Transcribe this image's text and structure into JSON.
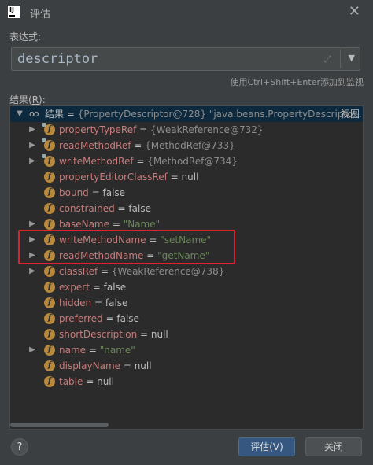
{
  "window": {
    "title": "评估"
  },
  "expression": {
    "label": "表达式:",
    "value": "descriptor",
    "hint": "使用Ctrl+Shift+Enter添加到监视"
  },
  "result": {
    "label_prefix": "结果(",
    "label_mnemonic": "R",
    "label_suffix": "):",
    "root": {
      "name": "结果",
      "eq": " = ",
      "value": "{PropertyDescriptor@728} \"java.beans.PropertyDescripto...",
      "view_link": "视图"
    },
    "fields": [
      {
        "name": "propertyTypeRef",
        "value": "{WeakReference@732}",
        "kind": "ref",
        "expandable": true,
        "locked": true
      },
      {
        "name": "readMethodRef",
        "value": "{MethodRef@733}",
        "kind": "ref",
        "expandable": true,
        "locked": true
      },
      {
        "name": "writeMethodRef",
        "value": "{MethodRef@734}",
        "kind": "ref",
        "expandable": true,
        "locked": true
      },
      {
        "name": "propertyEditorClassRef",
        "value": "null",
        "kind": "plain",
        "expandable": false,
        "locked": false
      },
      {
        "name": "bound",
        "value": "false",
        "kind": "plain",
        "expandable": false,
        "locked": false
      },
      {
        "name": "constrained",
        "value": "false",
        "kind": "plain",
        "expandable": false,
        "locked": false
      },
      {
        "name": "baseName",
        "value": "\"Name\"",
        "kind": "str",
        "expandable": true,
        "locked": false
      },
      {
        "name": "writeMethodName",
        "value": "\"setName\"",
        "kind": "str",
        "expandable": true,
        "locked": false
      },
      {
        "name": "readMethodName",
        "value": "\"getName\"",
        "kind": "str",
        "expandable": true,
        "locked": false
      },
      {
        "name": "classRef",
        "value": "{WeakReference@738}",
        "kind": "ref",
        "expandable": true,
        "locked": false
      },
      {
        "name": "expert",
        "value": "false",
        "kind": "plain",
        "expandable": false,
        "locked": false
      },
      {
        "name": "hidden",
        "value": "false",
        "kind": "plain",
        "expandable": false,
        "locked": false
      },
      {
        "name": "preferred",
        "value": "false",
        "kind": "plain",
        "expandable": false,
        "locked": false
      },
      {
        "name": "shortDescription",
        "value": "null",
        "kind": "plain",
        "expandable": false,
        "locked": false
      },
      {
        "name": "name",
        "value": "\"name\"",
        "kind": "str",
        "expandable": true,
        "locked": false
      },
      {
        "name": "displayName",
        "value": "null",
        "kind": "plain",
        "expandable": false,
        "locked": false
      },
      {
        "name": "table",
        "value": "null",
        "kind": "plain",
        "expandable": false,
        "locked": false
      }
    ]
  },
  "icons": {
    "app": "intellij-logo-icon",
    "close": "close-icon",
    "expand": "expand-icon",
    "dropdown": "chevron-down-icon",
    "field": "field-icon",
    "watch": "watch-icon",
    "help": "help-icon"
  },
  "buttons": {
    "evaluate": "评估(V)",
    "close": "关闭",
    "help": "?"
  },
  "colors": {
    "background": "#3c3f41",
    "tree_bg": "#2b2b2b",
    "selected_row": "#0d293e",
    "field_name": "#c77b7b",
    "string_value": "#6a8759",
    "highlight": "#e0202a",
    "primary_button": "#365880"
  }
}
